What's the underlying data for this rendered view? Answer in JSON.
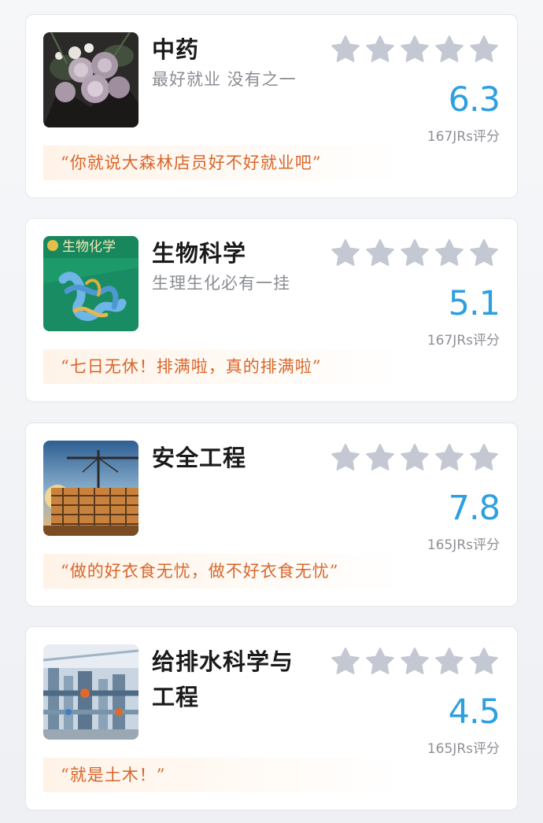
{
  "majors": [
    {
      "title": "中药",
      "subtitle": "最好就业 没有之一",
      "score": "6.3",
      "count": "167JRs评分",
      "quote": "“你就说大森林店员好不好就业吧”",
      "image_icon": "flower-bouquet-photo"
    },
    {
      "title": "生物科学",
      "subtitle": "生理生化必有一挂",
      "score": "5.1",
      "count": "167JRs评分",
      "quote": "“七日无休！排满啦，真的排满啦”",
      "image_icon": "biochemistry-textbook-cover",
      "book_title": "生物化学"
    },
    {
      "title": "安全工程",
      "subtitle": "",
      "score": "7.8",
      "count": "165JRs评分",
      "quote": "“做的好衣食无忧，做不好衣食无忧”",
      "image_icon": "construction-site-photo"
    },
    {
      "title": "给排水科学与工程",
      "subtitle": "",
      "score": "4.5",
      "count": "165JRs评分",
      "quote": "“就是土木！”",
      "image_icon": "water-pipes-photo"
    }
  ],
  "colors": {
    "score": "#2e9fe0",
    "quote_text": "#d8662b",
    "star": "#c4c8d2"
  }
}
